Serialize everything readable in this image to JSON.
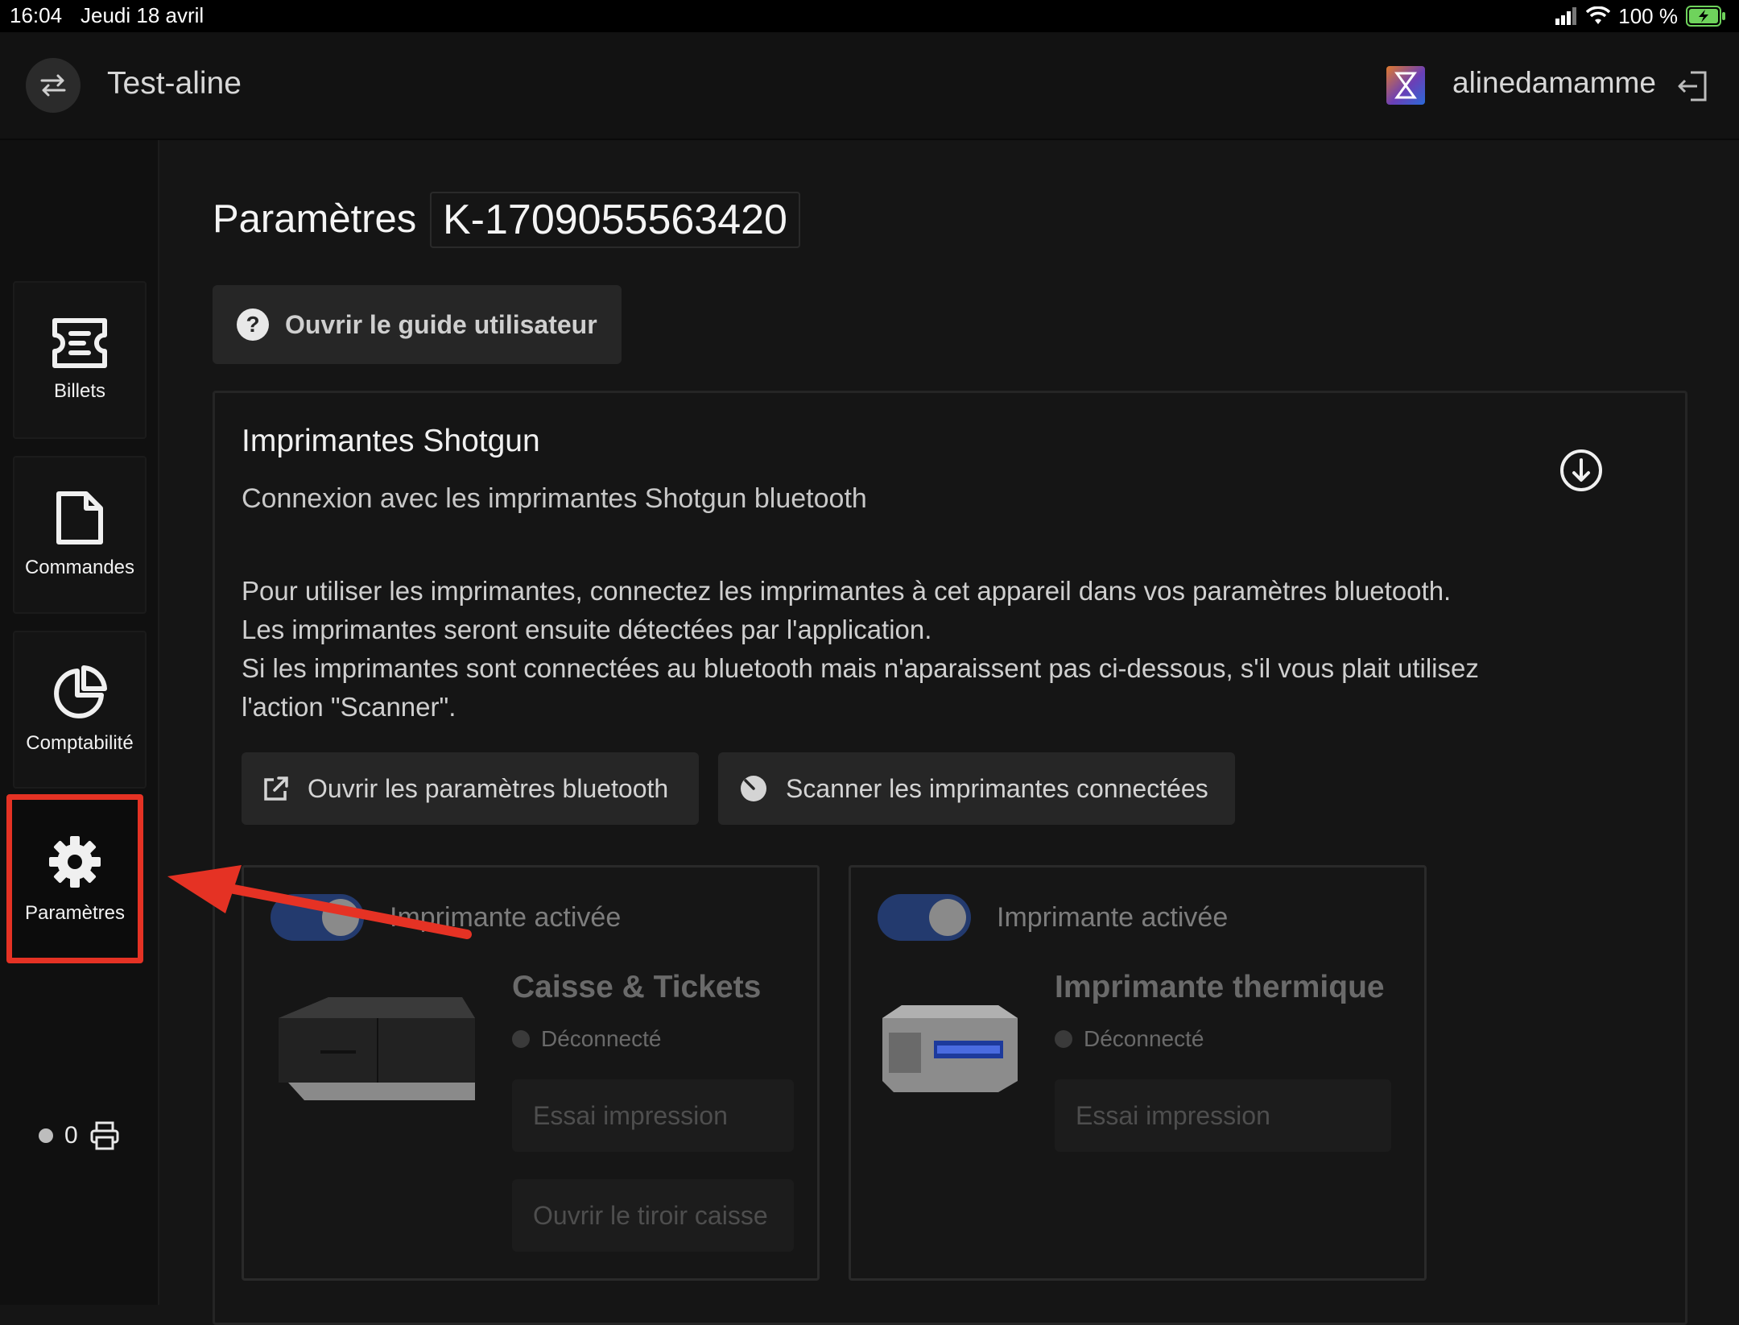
{
  "status_bar": {
    "time": "16:04",
    "date": "Jeudi 18 avril",
    "battery": "100 %"
  },
  "header": {
    "account_name": "Test-aline",
    "username": "alinedamamme",
    "icons": {
      "switch": "swap-arrows-icon",
      "logout": "logout-icon"
    }
  },
  "sidebar": {
    "items": [
      {
        "label": "Billets",
        "icon": "ticket-icon"
      },
      {
        "label": "Commandes",
        "icon": "document-icon"
      },
      {
        "label": "Comptabilité",
        "icon": "pie-chart-icon"
      },
      {
        "label": "Paramètres",
        "icon": "gear-icon",
        "active": true
      }
    ],
    "printer_count": "0"
  },
  "main": {
    "title": "Paramètres",
    "device_id": "K-1709055563420",
    "guide_button": "Ouvrir le guide utilisateur",
    "panel": {
      "title": "Imprimantes Shotgun",
      "subtitle": "Connexion avec les imprimantes Shotgun bluetooth",
      "description": [
        "Pour utiliser les imprimantes, connectez les imprimantes à cet appareil dans vos paramètres bluetooth.",
        "Les imprimantes seront ensuite détectées par l'application.",
        "Si les imprimantes sont connectées au bluetooth mais n'aparaissent pas ci-dessous, s'il vous plait utilisez",
        "l'action \"Scanner\"."
      ],
      "open_bluetooth_button": "Ouvrir les paramètres bluetooth",
      "scan_button": "Scanner les imprimantes connectées",
      "printers": [
        {
          "toggle_label": "Imprimante activée",
          "enabled": true,
          "name": "Caisse & Tickets",
          "status": "Déconnecté",
          "test_button": "Essai impression",
          "drawer_button": "Ouvrir le tiroir caisse"
        },
        {
          "toggle_label": "Imprimante activée",
          "enabled": true,
          "name": "Imprimante thermique",
          "status": "Déconnecté",
          "test_button": "Essai impression"
        }
      ]
    }
  },
  "colors": {
    "background": "#151515",
    "highlight": "#e53224",
    "toggle": "#233a6e",
    "button": "#262626"
  }
}
